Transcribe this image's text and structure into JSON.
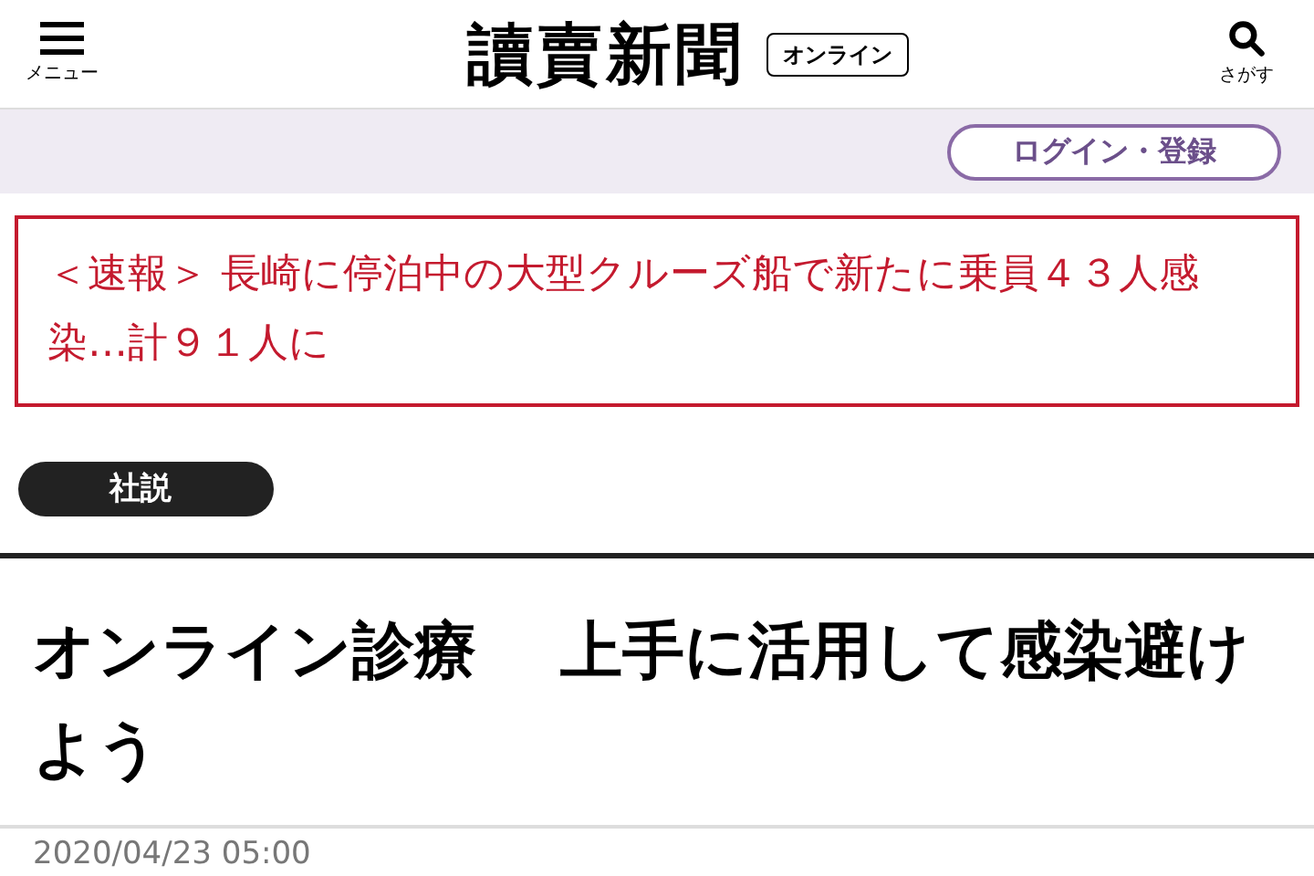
{
  "header": {
    "menu_label": "メニュー",
    "logo": "讀賣新聞",
    "logo_badge": "オンライン",
    "search_label": "さがす"
  },
  "account_bar": {
    "login_button": "ログイン・登録"
  },
  "breaking_news": {
    "text": "＜速報＞ 長崎に停泊中の大型クルーズ船で新たに乗員４３人感染…計９１人に"
  },
  "article": {
    "category": "社説",
    "headline": "オンライン診療　 上手に活用して感染避けよう",
    "date": "2020/04/23 05:00"
  }
}
